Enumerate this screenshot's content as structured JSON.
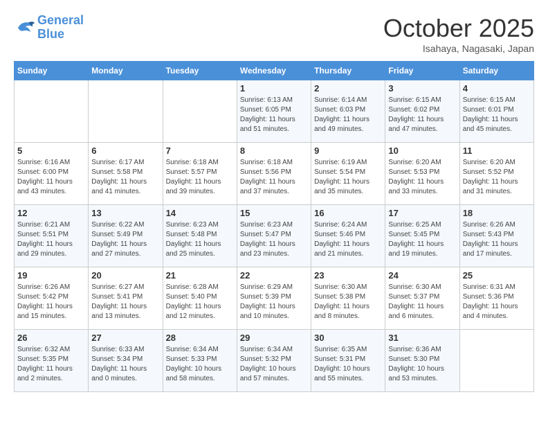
{
  "logo": {
    "line1": "General",
    "line2": "Blue"
  },
  "title": "October 2025",
  "location": "Isahaya, Nagasaki, Japan",
  "weekdays": [
    "Sunday",
    "Monday",
    "Tuesday",
    "Wednesday",
    "Thursday",
    "Friday",
    "Saturday"
  ],
  "weeks": [
    [
      {
        "day": "",
        "info": ""
      },
      {
        "day": "",
        "info": ""
      },
      {
        "day": "",
        "info": ""
      },
      {
        "day": "1",
        "info": "Sunrise: 6:13 AM\nSunset: 6:05 PM\nDaylight: 11 hours\nand 51 minutes."
      },
      {
        "day": "2",
        "info": "Sunrise: 6:14 AM\nSunset: 6:03 PM\nDaylight: 11 hours\nand 49 minutes."
      },
      {
        "day": "3",
        "info": "Sunrise: 6:15 AM\nSunset: 6:02 PM\nDaylight: 11 hours\nand 47 minutes."
      },
      {
        "day": "4",
        "info": "Sunrise: 6:15 AM\nSunset: 6:01 PM\nDaylight: 11 hours\nand 45 minutes."
      }
    ],
    [
      {
        "day": "5",
        "info": "Sunrise: 6:16 AM\nSunset: 6:00 PM\nDaylight: 11 hours\nand 43 minutes."
      },
      {
        "day": "6",
        "info": "Sunrise: 6:17 AM\nSunset: 5:58 PM\nDaylight: 11 hours\nand 41 minutes."
      },
      {
        "day": "7",
        "info": "Sunrise: 6:18 AM\nSunset: 5:57 PM\nDaylight: 11 hours\nand 39 minutes."
      },
      {
        "day": "8",
        "info": "Sunrise: 6:18 AM\nSunset: 5:56 PM\nDaylight: 11 hours\nand 37 minutes."
      },
      {
        "day": "9",
        "info": "Sunrise: 6:19 AM\nSunset: 5:54 PM\nDaylight: 11 hours\nand 35 minutes."
      },
      {
        "day": "10",
        "info": "Sunrise: 6:20 AM\nSunset: 5:53 PM\nDaylight: 11 hours\nand 33 minutes."
      },
      {
        "day": "11",
        "info": "Sunrise: 6:20 AM\nSunset: 5:52 PM\nDaylight: 11 hours\nand 31 minutes."
      }
    ],
    [
      {
        "day": "12",
        "info": "Sunrise: 6:21 AM\nSunset: 5:51 PM\nDaylight: 11 hours\nand 29 minutes."
      },
      {
        "day": "13",
        "info": "Sunrise: 6:22 AM\nSunset: 5:49 PM\nDaylight: 11 hours\nand 27 minutes."
      },
      {
        "day": "14",
        "info": "Sunrise: 6:23 AM\nSunset: 5:48 PM\nDaylight: 11 hours\nand 25 minutes."
      },
      {
        "day": "15",
        "info": "Sunrise: 6:23 AM\nSunset: 5:47 PM\nDaylight: 11 hours\nand 23 minutes."
      },
      {
        "day": "16",
        "info": "Sunrise: 6:24 AM\nSunset: 5:46 PM\nDaylight: 11 hours\nand 21 minutes."
      },
      {
        "day": "17",
        "info": "Sunrise: 6:25 AM\nSunset: 5:45 PM\nDaylight: 11 hours\nand 19 minutes."
      },
      {
        "day": "18",
        "info": "Sunrise: 6:26 AM\nSunset: 5:43 PM\nDaylight: 11 hours\nand 17 minutes."
      }
    ],
    [
      {
        "day": "19",
        "info": "Sunrise: 6:26 AM\nSunset: 5:42 PM\nDaylight: 11 hours\nand 15 minutes."
      },
      {
        "day": "20",
        "info": "Sunrise: 6:27 AM\nSunset: 5:41 PM\nDaylight: 11 hours\nand 13 minutes."
      },
      {
        "day": "21",
        "info": "Sunrise: 6:28 AM\nSunset: 5:40 PM\nDaylight: 11 hours\nand 12 minutes."
      },
      {
        "day": "22",
        "info": "Sunrise: 6:29 AM\nSunset: 5:39 PM\nDaylight: 11 hours\nand 10 minutes."
      },
      {
        "day": "23",
        "info": "Sunrise: 6:30 AM\nSunset: 5:38 PM\nDaylight: 11 hours\nand 8 minutes."
      },
      {
        "day": "24",
        "info": "Sunrise: 6:30 AM\nSunset: 5:37 PM\nDaylight: 11 hours\nand 6 minutes."
      },
      {
        "day": "25",
        "info": "Sunrise: 6:31 AM\nSunset: 5:36 PM\nDaylight: 11 hours\nand 4 minutes."
      }
    ],
    [
      {
        "day": "26",
        "info": "Sunrise: 6:32 AM\nSunset: 5:35 PM\nDaylight: 11 hours\nand 2 minutes."
      },
      {
        "day": "27",
        "info": "Sunrise: 6:33 AM\nSunset: 5:34 PM\nDaylight: 11 hours\nand 0 minutes."
      },
      {
        "day": "28",
        "info": "Sunrise: 6:34 AM\nSunset: 5:33 PM\nDaylight: 10 hours\nand 58 minutes."
      },
      {
        "day": "29",
        "info": "Sunrise: 6:34 AM\nSunset: 5:32 PM\nDaylight: 10 hours\nand 57 minutes."
      },
      {
        "day": "30",
        "info": "Sunrise: 6:35 AM\nSunset: 5:31 PM\nDaylight: 10 hours\nand 55 minutes."
      },
      {
        "day": "31",
        "info": "Sunrise: 6:36 AM\nSunset: 5:30 PM\nDaylight: 10 hours\nand 53 minutes."
      },
      {
        "day": "",
        "info": ""
      }
    ]
  ]
}
